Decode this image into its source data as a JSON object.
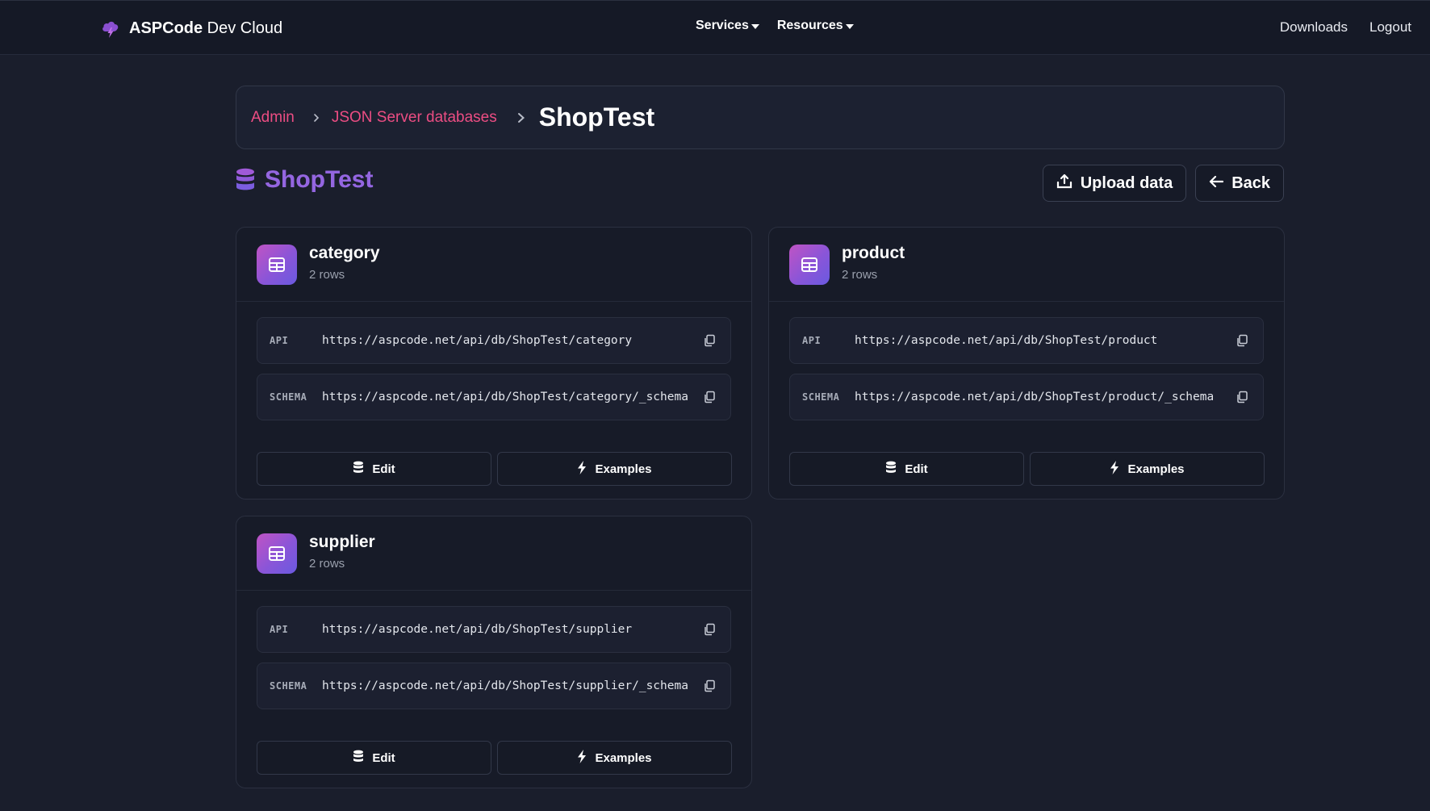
{
  "nav": {
    "brand_bold": "ASPCode",
    "brand_rest": " Dev Cloud",
    "menu": [
      {
        "label": "Services"
      },
      {
        "label": "Resources"
      }
    ],
    "right_links": [
      {
        "label": "Downloads"
      },
      {
        "label": "Logout"
      }
    ]
  },
  "breadcrumb": {
    "items": [
      {
        "label": "Admin"
      },
      {
        "label": "JSON Server databases"
      }
    ],
    "current": "ShopTest"
  },
  "page": {
    "title": "ShopTest",
    "upload_label": "Upload data",
    "back_label": "Back"
  },
  "tables": [
    {
      "name": "category",
      "rows": "2 rows",
      "api_label": "API",
      "api_url": "https://aspcode.net/api/db/ShopTest/category",
      "schema_label": "SCHEMA",
      "schema_url": "https://aspcode.net/api/db/ShopTest/category/_schema",
      "edit_label": "Edit",
      "examples_label": "Examples"
    },
    {
      "name": "product",
      "rows": "2 rows",
      "api_label": "API",
      "api_url": "https://aspcode.net/api/db/ShopTest/product",
      "schema_label": "SCHEMA",
      "schema_url": "https://aspcode.net/api/db/ShopTest/product/_schema",
      "edit_label": "Edit",
      "examples_label": "Examples"
    },
    {
      "name": "supplier",
      "rows": "2 rows",
      "api_label": "API",
      "api_url": "https://aspcode.net/api/db/ShopTest/supplier",
      "schema_label": "SCHEMA",
      "schema_url": "https://aspcode.net/api/db/ShopTest/supplier/_schema",
      "edit_label": "Edit",
      "examples_label": "Examples"
    }
  ],
  "colors": {
    "background": "#1a1e2c",
    "navbar": "#151926",
    "link_pink": "#ec4d83",
    "accent_purple": "#9466e0"
  },
  "icons": {
    "brand": "cloud-bolt-icon",
    "database": "database-icon",
    "table": "table-icon",
    "copy": "copy-icon",
    "upload": "upload-icon",
    "back": "arrow-left-icon",
    "edit": "database-icon",
    "examples": "bolt-icon"
  }
}
